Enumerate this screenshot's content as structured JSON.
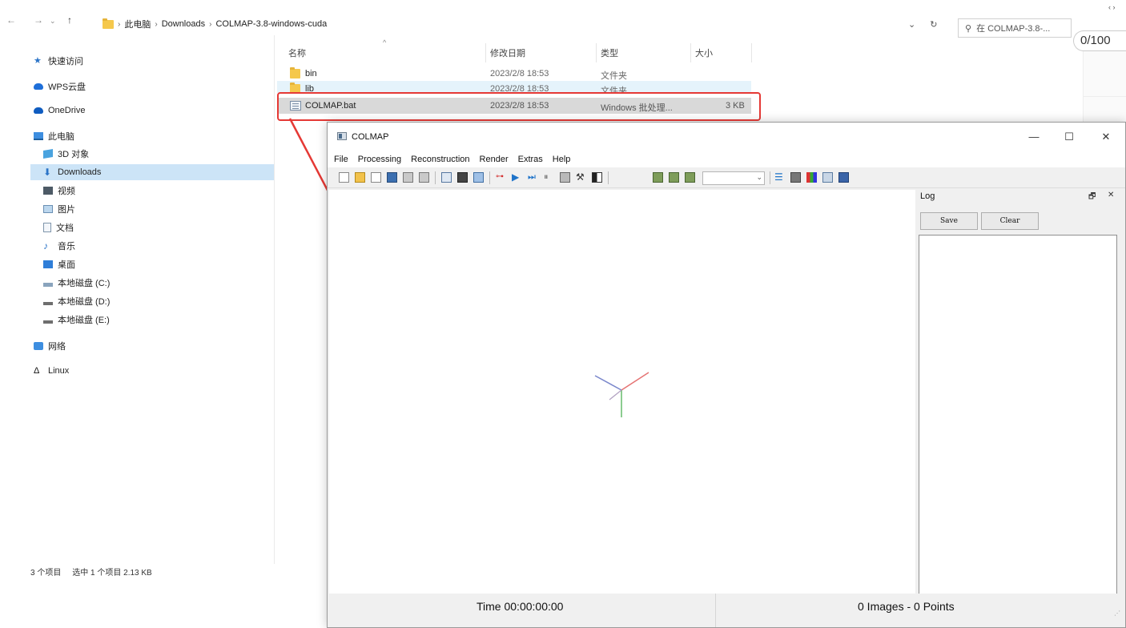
{
  "explorer": {
    "breadcrumb": [
      "此电脑",
      "Downloads",
      "COLMAP-3.8-windows-cuda"
    ],
    "search_placeholder": "在 COLMAP-3.8-...",
    "page_chip": "0/100",
    "sidebar": [
      {
        "label": "快速访问",
        "icon": "pin-icon"
      },
      {
        "label": "WPS云盘",
        "icon": "cloud-icon"
      },
      {
        "label": "OneDrive",
        "icon": "cloud-icon"
      },
      {
        "label": "此电脑",
        "icon": "computer-icon"
      },
      {
        "label": "3D 对象",
        "icon": "cube-icon"
      },
      {
        "label": "Downloads",
        "icon": "download-icon"
      },
      {
        "label": "视频",
        "icon": "video-icon"
      },
      {
        "label": "图片",
        "icon": "image-icon"
      },
      {
        "label": "文档",
        "icon": "document-icon"
      },
      {
        "label": "音乐",
        "icon": "music-icon"
      },
      {
        "label": "桌面",
        "icon": "desktop-icon"
      },
      {
        "label": "本地磁盘 (C:)",
        "icon": "drive-icon"
      },
      {
        "label": "本地磁盘 (D:)",
        "icon": "drive-icon"
      },
      {
        "label": "本地磁盘 (E:)",
        "icon": "drive-icon"
      },
      {
        "label": "网络",
        "icon": "network-icon"
      },
      {
        "label": "Linux",
        "icon": "linux-icon"
      }
    ],
    "columns": [
      "名称",
      "修改日期",
      "类型",
      "大小"
    ],
    "files": [
      {
        "name": "bin",
        "date": "2023/2/8 18:53",
        "type": "文件夹",
        "size": ""
      },
      {
        "name": "lib",
        "date": "2023/2/8 18:53",
        "type": "文件夹",
        "size": ""
      },
      {
        "name": "COLMAP.bat",
        "date": "2023/2/8 18:53",
        "type": "Windows 批处理...",
        "size": "3 KB"
      }
    ],
    "status_items": "3 个项目",
    "status_selected": "选中 1 个项目  2.13 KB"
  },
  "colmap": {
    "title": "COLMAP",
    "window_buttons": {
      "minimize": "—",
      "maximize": "☐",
      "close": "✕"
    },
    "menu": [
      "File",
      "Processing",
      "Reconstruction",
      "Render",
      "Extras",
      "Help"
    ],
    "log": {
      "title": "Log",
      "save_label": "Save",
      "clear_label": "Clear",
      "float_glyph": "🗗",
      "close_glyph": "✕"
    },
    "status": {
      "time": "Time 00:00:00:00",
      "counts": "0 Images - 0 Points"
    }
  },
  "colors": {
    "highlight": "#e53935",
    "selection": "#cce4f7",
    "axis_x": "#e57373",
    "axis_y": "#66bb6a",
    "axis_z": "#7986cb"
  }
}
